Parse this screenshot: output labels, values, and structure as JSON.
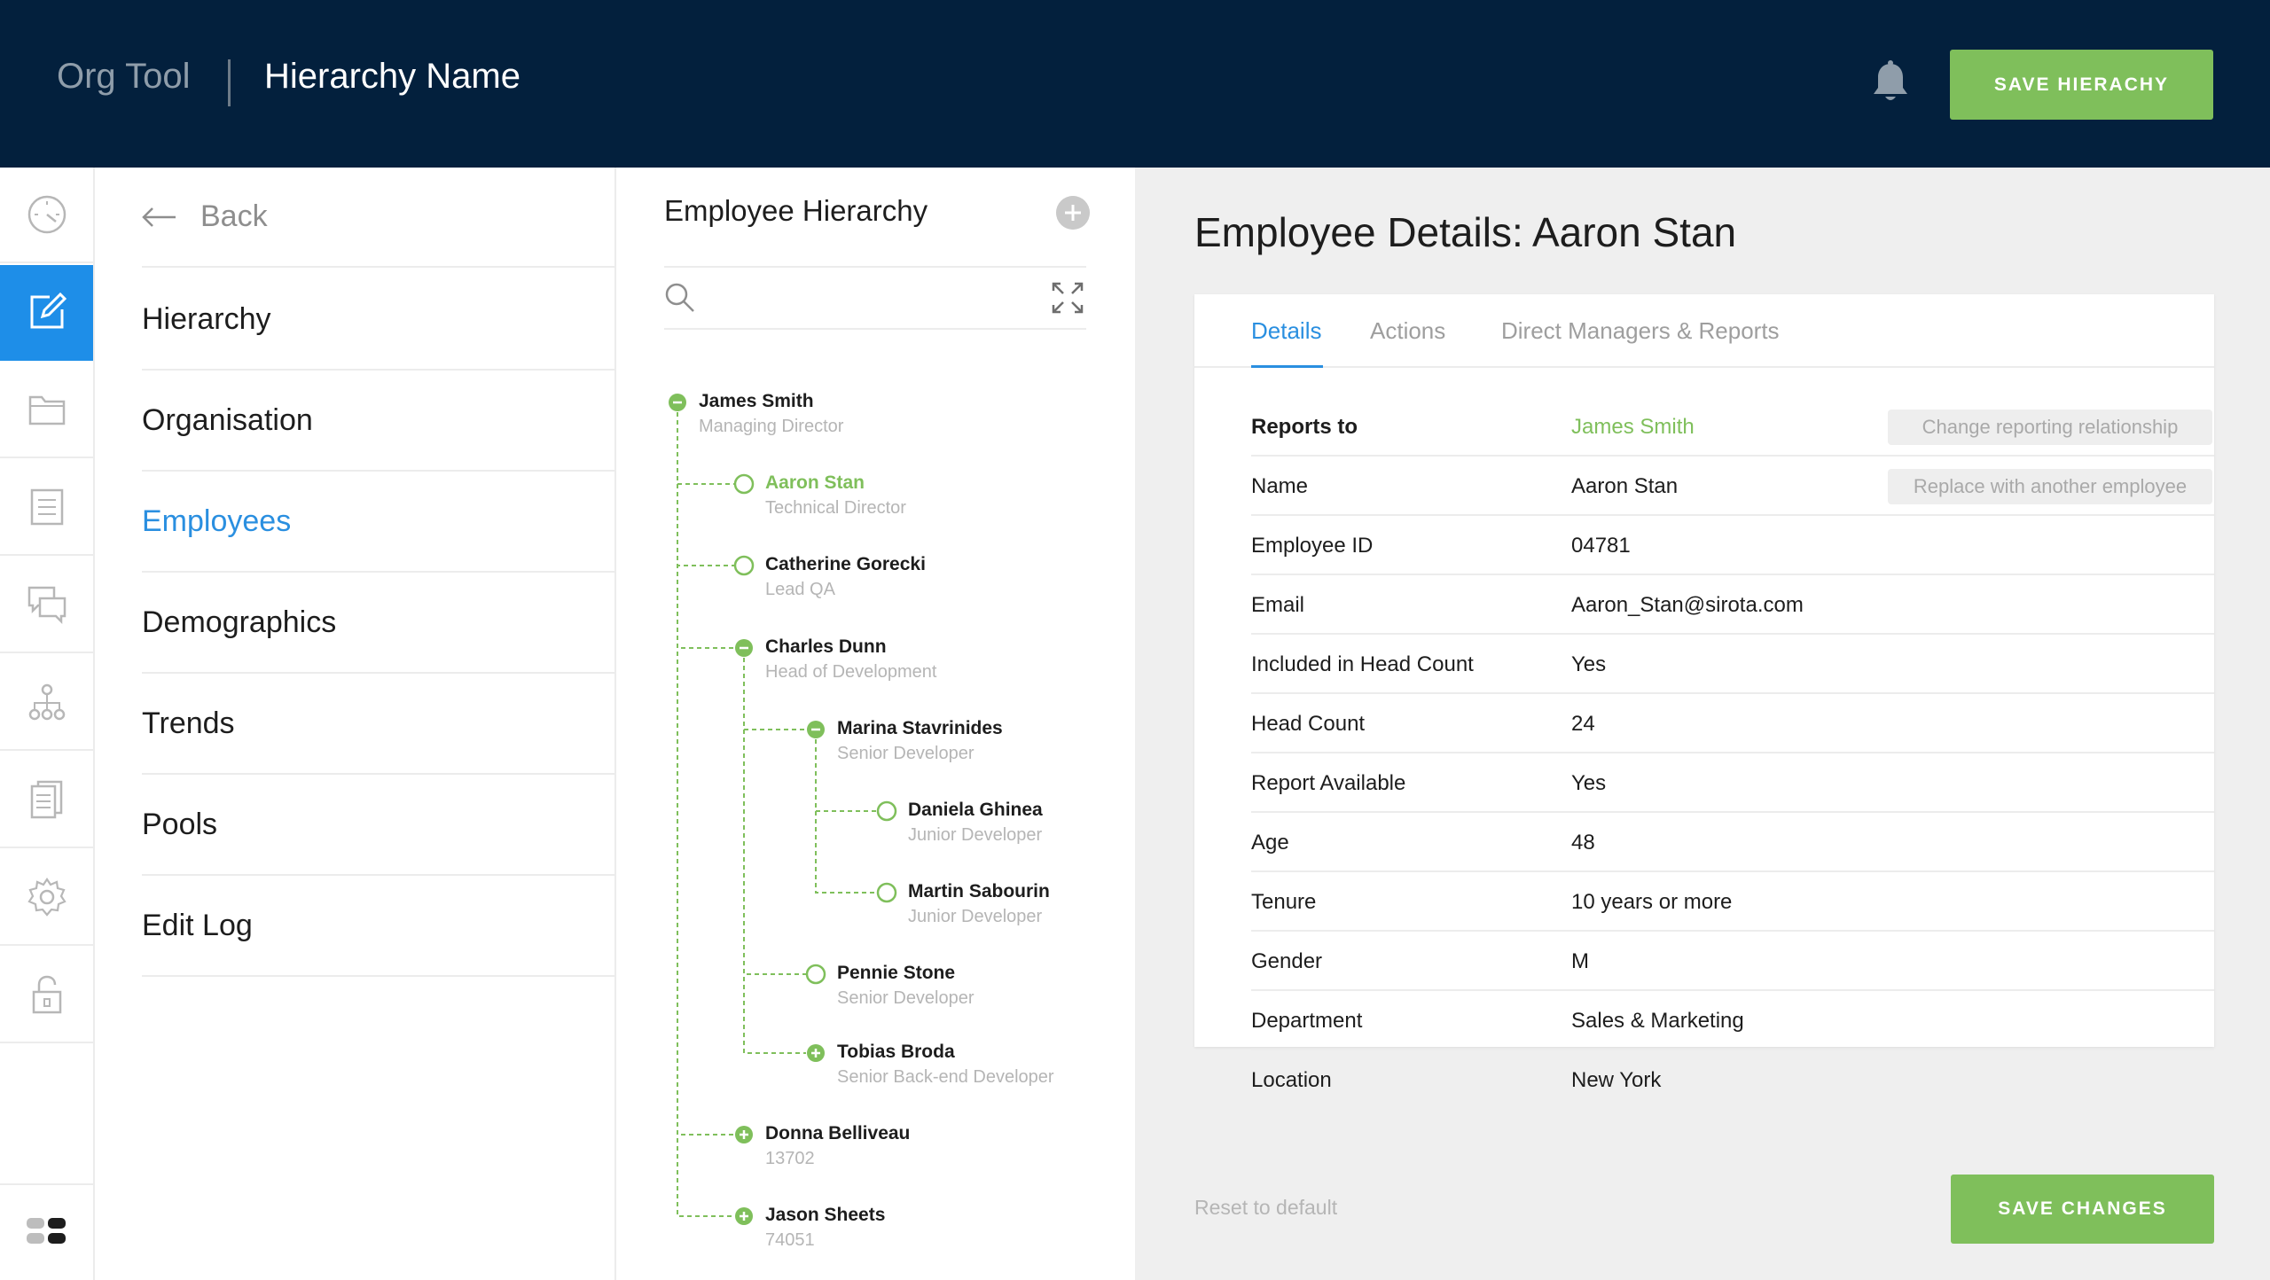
{
  "header": {
    "app_name": "Org Tool",
    "hierarchy_name": "Hierarchy Name",
    "save_button": "SAVE HIERACHY"
  },
  "rail": {
    "items": [
      "dashboard-icon",
      "edit-icon",
      "folder-icon",
      "list-icon",
      "comments-icon",
      "org-chart-icon",
      "documents-icon",
      "settings-icon",
      "lock-icon"
    ],
    "active_index": 1,
    "bottom": "toggle-icon"
  },
  "nav": {
    "back_label": "Back",
    "items": [
      {
        "label": "Hierarchy"
      },
      {
        "label": "Organisation"
      },
      {
        "label": "Employees",
        "active": true
      },
      {
        "label": "Demographics"
      },
      {
        "label": "Trends"
      },
      {
        "label": "Pools"
      },
      {
        "label": "Edit Log"
      }
    ]
  },
  "hierarchy": {
    "title": "Employee Hierarchy",
    "search_placeholder": "",
    "nodes": [
      {
        "name": "James Smith",
        "subtitle": "Managing Director",
        "state": "expanded",
        "level": 0
      },
      {
        "name": "Aaron Stan",
        "subtitle": "Technical Director",
        "state": "empty",
        "level": 1,
        "selected": true
      },
      {
        "name": "Catherine Gorecki",
        "subtitle": "Lead QA",
        "state": "empty",
        "level": 1
      },
      {
        "name": "Charles Dunn",
        "subtitle": "Head of Development",
        "state": "expanded",
        "level": 1
      },
      {
        "name": "Marina Stavrinides",
        "subtitle": "Senior Developer",
        "state": "expanded",
        "level": 2
      },
      {
        "name": "Daniela Ghinea",
        "subtitle": "Junior Developer",
        "state": "empty",
        "level": 3
      },
      {
        "name": "Martin Sabourin",
        "subtitle": "Junior Developer",
        "state": "empty",
        "level": 3
      },
      {
        "name": "Pennie Stone",
        "subtitle": "Senior Developer",
        "state": "empty",
        "level": 2
      },
      {
        "name": "Tobias Broda",
        "subtitle": "Senior Back-end Developer",
        "state": "collapsed",
        "level": 2
      },
      {
        "name": "Donna Belliveau",
        "subtitle": "13702",
        "state": "collapsed",
        "level": 1
      },
      {
        "name": "Jason Sheets",
        "subtitle": "74051",
        "state": "collapsed",
        "level": 1
      }
    ]
  },
  "details": {
    "title": "Employee Details: Aaron Stan",
    "tabs": [
      {
        "label": "Details",
        "active": true
      },
      {
        "label": "Actions"
      },
      {
        "label": "Direct Managers & Reports"
      }
    ],
    "rows": [
      {
        "label": "Reports to",
        "value": "James Smith",
        "action": "Change reporting relationship"
      },
      {
        "label": "Name",
        "value": "Aaron Stan",
        "action": "Replace with another employee"
      },
      {
        "label": "Employee ID",
        "value": "04781"
      },
      {
        "label": "Email",
        "value": "Aaron_Stan@sirota.com"
      },
      {
        "label": "Included in Head Count",
        "value": "Yes"
      },
      {
        "label": "Head Count",
        "value": "24"
      },
      {
        "label": "Report Available",
        "value": "Yes"
      },
      {
        "label": "Age",
        "value": "48"
      },
      {
        "label": "Tenure",
        "value": "10 years or more"
      },
      {
        "label": "Gender",
        "value": "M"
      },
      {
        "label": "Department",
        "value": "Sales & Marketing"
      },
      {
        "label": "Location",
        "value": "New York"
      }
    ],
    "reset_label": "Reset to default",
    "save_label": "SAVE CHANGES"
  },
  "colors": {
    "header_bg": "#03203d",
    "accent_green": "#7fbf5b",
    "accent_blue": "#2a8fe0",
    "muted_text": "#b5b5b5"
  }
}
